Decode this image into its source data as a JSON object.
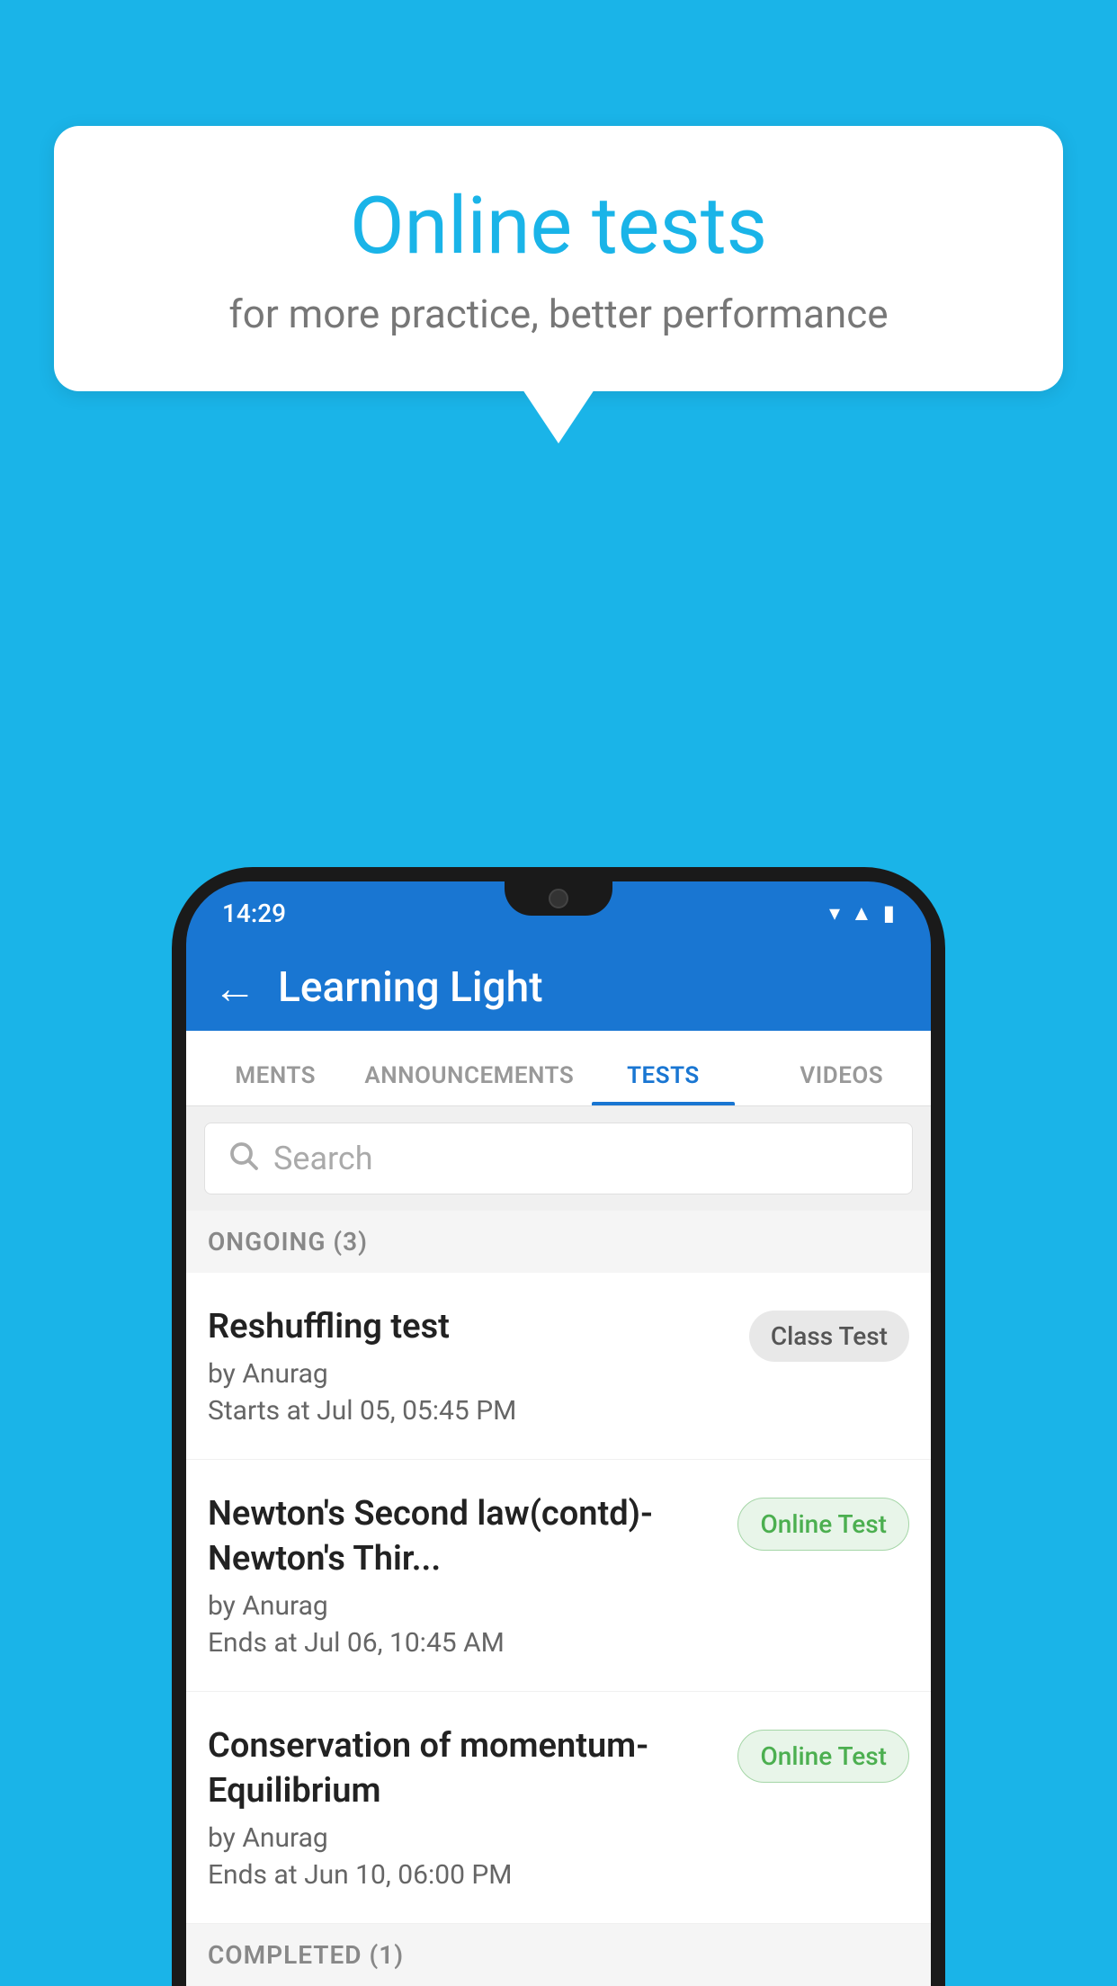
{
  "background": {
    "color": "#1ab4e8"
  },
  "speech_bubble": {
    "title": "Online tests",
    "subtitle": "for more practice, better performance"
  },
  "phone": {
    "status_bar": {
      "time": "14:29",
      "icons": [
        "wifi",
        "signal",
        "battery"
      ]
    },
    "app_header": {
      "title": "Learning Light",
      "back_label": "←"
    },
    "tabs": [
      {
        "label": "MENTS",
        "active": false
      },
      {
        "label": "ANNOUNCEMENTS",
        "active": false
      },
      {
        "label": "TESTS",
        "active": true
      },
      {
        "label": "VIDEOS",
        "active": false
      }
    ],
    "search": {
      "placeholder": "Search"
    },
    "ongoing_section": {
      "header": "ONGOING (3)",
      "items": [
        {
          "name": "Reshuffling test",
          "author": "by Anurag",
          "time_label": "Starts at",
          "time": "Jul 05, 05:45 PM",
          "badge": "Class Test",
          "badge_type": "class"
        },
        {
          "name": "Newton's Second law(contd)-Newton's Thir...",
          "author": "by Anurag",
          "time_label": "Ends at",
          "time": "Jul 06, 10:45 AM",
          "badge": "Online Test",
          "badge_type": "online"
        },
        {
          "name": "Conservation of momentum-Equilibrium",
          "author": "by Anurag",
          "time_label": "Ends at",
          "time": "Jun 10, 06:00 PM",
          "badge": "Online Test",
          "badge_type": "online"
        }
      ]
    },
    "completed_section": {
      "header": "COMPLETED (1)"
    }
  }
}
